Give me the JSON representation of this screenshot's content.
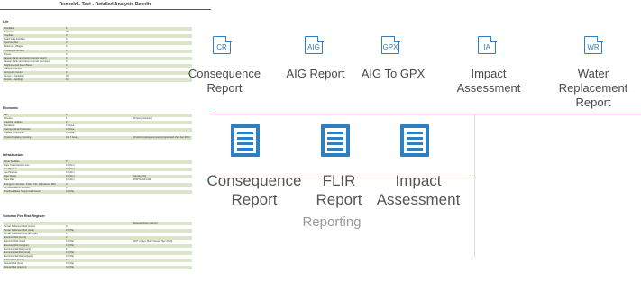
{
  "document": {
    "title": "Dunkeld - Test - Detailed Analysis Results",
    "sections": [
      {
        "heading": "Life",
        "rows": [
          [
            "Population",
            "4",
            ""
          ],
          [
            "Properties",
            "38",
            ""
          ],
          [
            "Hospitals",
            "0",
            ""
          ],
          [
            "Health Care Facilities",
            "0",
            ""
          ],
          [
            "Aged Facilities",
            "0",
            ""
          ],
          [
            "Retirement Villages",
            "0",
            ""
          ],
          [
            "Schools/Pre schools",
            "0",
            ""
          ],
          [
            "Prisons",
            "0",
            ""
          ],
          [
            "Caravan Parks and Camp Grounds (count)",
            "0",
            ""
          ],
          [
            "Caravan Parks and Camp Grounds (occupied)",
            "0",
            ""
          ],
          [
            "Neighbourhood Safer Places",
            "0",
            ""
          ],
          [
            "Transport Centres",
            "0",
            ""
          ],
          [
            "Community Centres",
            "0",
            ""
          ],
          [
            "Census - Population",
            "30",
            ""
          ],
          [
            "Census - Dwellings",
            "10",
            ""
          ]
        ]
      },
      {
        "heading": "Economic",
        "rows": [
          [
            "Rail",
            "0",
            ""
          ],
          [
            "Wineries",
            "1",
            "Property (wineries)"
          ],
          [
            "Industrial Facilities",
            "0",
            ""
          ],
          [
            "Plantations",
            "0.0 Area",
            ""
          ],
          [
            "Grazing Animal Production",
            "0.0 Area",
            ""
          ],
          [
            "Irrigated Horticulture",
            "0.0 Area",
            ""
          ],
          [
            "Dryland Cropping / Grazing",
            "438.7 Area",
            "Dryland cropping and grazing (grassland short fuel 20%)"
          ]
        ]
      },
      {
        "heading": "Infrastructure",
        "rows": [
          [
            "Power Facilities",
            "0",
            ""
          ],
          [
            "Major Transmission Lines",
            "0.0 (Km)",
            ""
          ],
          [
            "Gas Pipelines",
            "0.0 (Km)",
            ""
          ],
          [
            "Gas Pipelines",
            "0.0 (Km)",
            ""
          ],
          [
            "Major Roads",
            "0.0 (Km)",
            "Glenelg Hwy"
          ],
          [
            "Major Rail",
            "0.0 (Km)",
            "PORTLAND LINE"
          ],
          [
            "Emergency Services - Police, Fire, Ambulance, SES",
            "0",
            ""
          ],
          [
            "Communications Services",
            "0",
            ""
          ],
          [
            "Prioritised Water Supply Catchments",
            "0.0 (Ha)",
            ""
          ]
        ]
      },
      {
        "heading": "Victorian Fire Risk Register",
        "rows": [
          [
            "",
            "",
            "Relevant Risks (ratings)"
          ],
          [
            "Human Settlement Risk (count)",
            "0",
            ""
          ],
          [
            "Human Settlement Risk (Area)",
            "0.0 (Ha)",
            ""
          ],
          [
            "Human Settlement Risk (at Buyer)",
            "0",
            ""
          ],
          [
            "Economic Risk (count)",
            "0",
            ""
          ],
          [
            "Economic Risk (Area)",
            "0.0 (Ha)",
            "WVT 2 (Very High)\nGlenelg Hwy (High)"
          ],
          [
            "Economic Risk (polygon)",
            "0.0 (Ha)",
            ""
          ],
          [
            "Environmental Risk (count)",
            "0",
            ""
          ],
          [
            "Environmental Risk (Area)",
            "0.0 (Ha)",
            ""
          ],
          [
            "Environmental Risk (polygon)",
            "0.0 (Ha)",
            ""
          ],
          [
            "Cultural Risk (count)",
            "0",
            ""
          ],
          [
            "Cultural Risk (Area)",
            "0.0 (Ha)",
            ""
          ],
          [
            "Cultural Risk (polygon)",
            "0.0 (Ha)",
            ""
          ]
        ]
      }
    ]
  },
  "ribbon_top": [
    {
      "label": "Consequence\nReport",
      "abbr": "CR",
      "icon": "cr-report-icon"
    },
    {
      "label": "AIG Report",
      "abbr": "AIG",
      "icon": "aig-report-icon"
    },
    {
      "label": "AIG To GPX",
      "abbr": "GPX",
      "icon": "gpx-icon"
    },
    {
      "label": "Impact\nAssessment",
      "abbr": "IA",
      "icon": "ia-icon"
    },
    {
      "label": "Water\nReplacement\nReport",
      "abbr": "WR",
      "icon": "wr-icon"
    }
  ],
  "ribbon_large": [
    {
      "label": "Consequence\nReport",
      "icon": "document-icon"
    },
    {
      "label": "FLIR\nReport",
      "icon": "document-icon"
    },
    {
      "label": "Impact\nAssessment",
      "icon": "document-icon"
    }
  ],
  "group_label": "Reporting",
  "colors": {
    "icon_blue": "#2f7fc1",
    "divider_red": "#9b2d3b",
    "row_green": "#d9e6c9"
  }
}
